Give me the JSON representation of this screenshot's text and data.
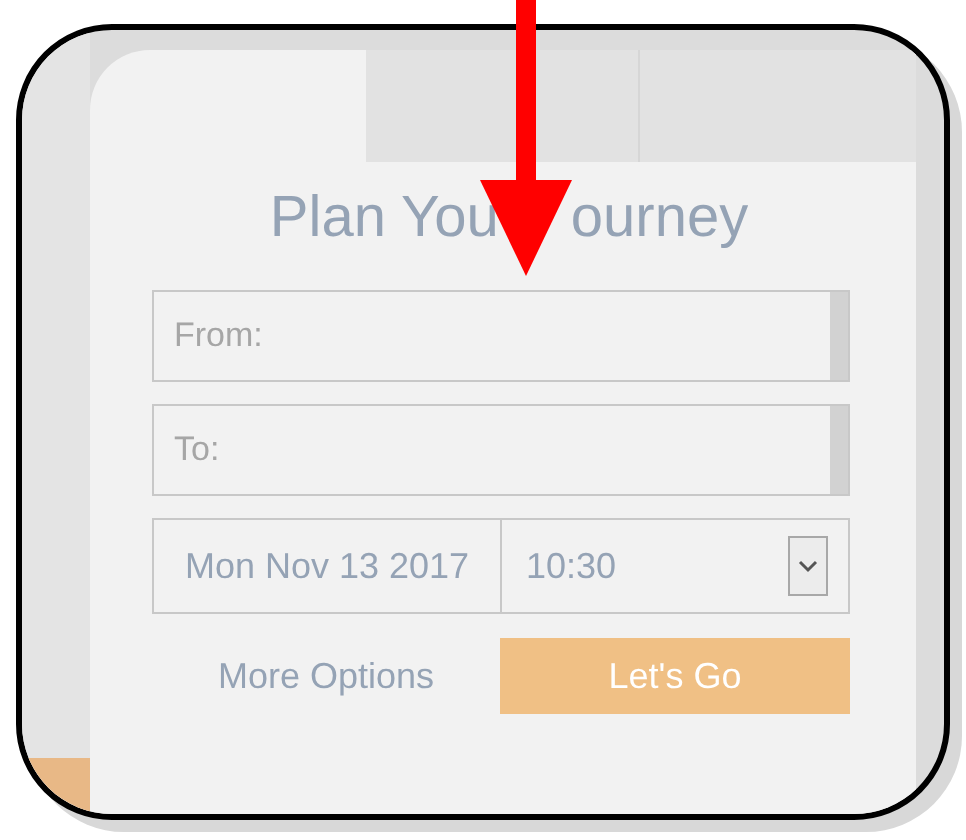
{
  "title": [
    "Plan You",
    "ourney"
  ],
  "fields": [
    {
      "placeholder": "From:"
    },
    {
      "placeholder": "To:"
    }
  ],
  "date": "Mon Nov 13 2017",
  "time": "10:30",
  "more_options": "More Options",
  "submit": "Let's Go"
}
